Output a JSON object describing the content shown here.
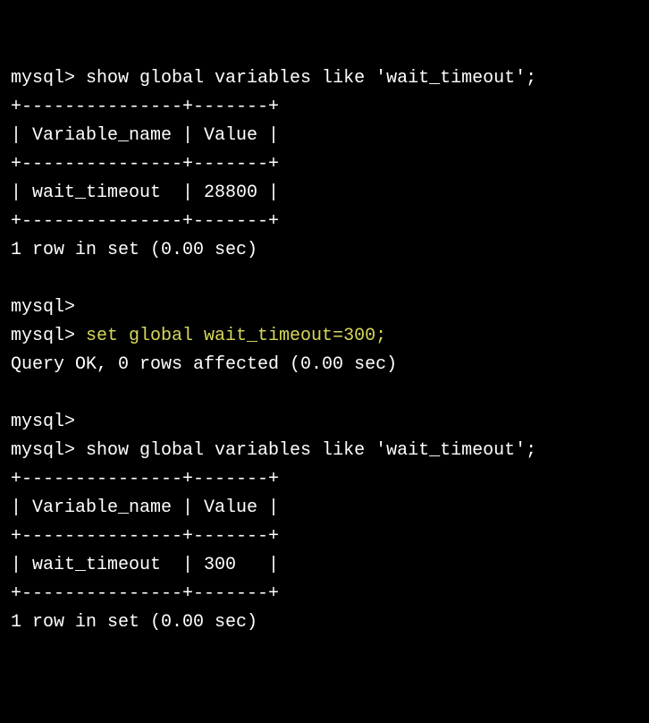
{
  "prompt": "mysql>",
  "block1": {
    "command": " show global variables like 'wait_timeout';",
    "border_top": "+---------------+-------+",
    "header": "| Variable_name | Value |",
    "border_mid": "+---------------+-------+",
    "row": "| wait_timeout  | 28800 |",
    "border_bot": "+---------------+-------+",
    "status": "1 row in set (0.00 sec)"
  },
  "block2": {
    "command": " set global wait_timeout=300;",
    "status": "Query OK, 0 rows affected (0.00 sec)"
  },
  "block3": {
    "command": " show global variables like 'wait_timeout';",
    "border_top": "+---------------+-------+",
    "header": "| Variable_name | Value |",
    "border_mid": "+---------------+-------+",
    "row": "| wait_timeout  | 300   |",
    "border_bot": "+---------------+-------+",
    "status": "1 row in set (0.00 sec)"
  }
}
